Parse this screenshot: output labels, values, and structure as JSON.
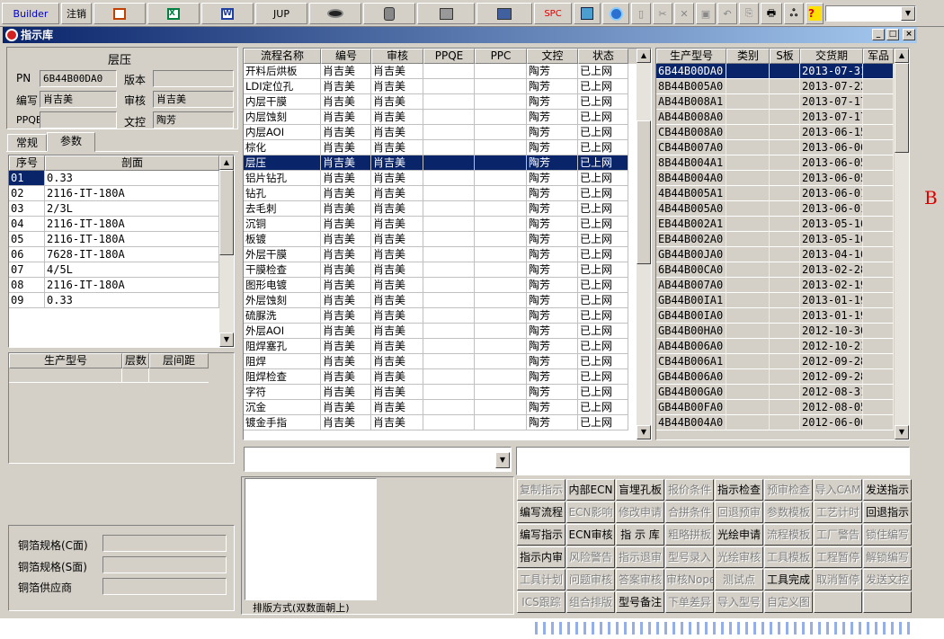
{
  "toolbar": {
    "builder": "Builder",
    "logout": "注销",
    "jup": "JUP",
    "spc": "SPC"
  },
  "window": {
    "title": "指示库"
  },
  "left": {
    "group_title": "层压",
    "pn_label": "PN",
    "pn_value": "6B44B00DA0",
    "version_label": "版本",
    "version_value": "",
    "writer_label": "编写",
    "writer_value": "肖吉美",
    "reviewer_label": "审核",
    "reviewer_value": "肖吉美",
    "ppqe_label": "PPQE",
    "ppqe_value": "",
    "doc_label": "文控",
    "doc_value": "陶芳",
    "tabs": [
      "常规",
      "参数"
    ],
    "param_headers": [
      "序号",
      "剖面"
    ],
    "params": [
      [
        "01",
        "0.33"
      ],
      [
        "02",
        "2116-IT-180A"
      ],
      [
        "03",
        "2/3L"
      ],
      [
        "04",
        "2116-IT-180A"
      ],
      [
        "05",
        "2116-IT-180A"
      ],
      [
        "06",
        "7628-IT-180A"
      ],
      [
        "07",
        "4/5L"
      ],
      [
        "08",
        "2116-IT-180A"
      ],
      [
        "09",
        "0.33"
      ]
    ],
    "model_headers": [
      "生产型号",
      "层数",
      "层间距"
    ],
    "copper_c_label": "铜箔规格(C面)",
    "copper_s_label": "铜箔规格(S面)",
    "copper_supplier_label": "铜箔供应商"
  },
  "process": {
    "headers": [
      "流程名称",
      "编号",
      "审核",
      "PPQE",
      "PPC",
      "文控",
      "状态"
    ],
    "rows": [
      [
        "开料后烘板",
        "肖吉美",
        "肖吉美",
        "",
        "",
        "陶芳",
        "已上网"
      ],
      [
        "LDI定位孔",
        "肖吉美",
        "肖吉美",
        "",
        "",
        "陶芳",
        "已上网"
      ],
      [
        "内层干膜",
        "肖吉美",
        "肖吉美",
        "",
        "",
        "陶芳",
        "已上网"
      ],
      [
        "内层蚀刻",
        "肖吉美",
        "肖吉美",
        "",
        "",
        "陶芳",
        "已上网"
      ],
      [
        "内层AOI",
        "肖吉美",
        "肖吉美",
        "",
        "",
        "陶芳",
        "已上网"
      ],
      [
        "棕化",
        "肖吉美",
        "肖吉美",
        "",
        "",
        "陶芳",
        "已上网"
      ],
      [
        "层压",
        "肖吉美",
        "肖吉美",
        "",
        "",
        "陶芳",
        "已上网"
      ],
      [
        "铝片钻孔",
        "肖吉美",
        "肖吉美",
        "",
        "",
        "陶芳",
        "已上网"
      ],
      [
        "钻孔",
        "肖吉美",
        "肖吉美",
        "",
        "",
        "陶芳",
        "已上网"
      ],
      [
        "去毛刺",
        "肖吉美",
        "肖吉美",
        "",
        "",
        "陶芳",
        "已上网"
      ],
      [
        "沉铜",
        "肖吉美",
        "肖吉美",
        "",
        "",
        "陶芳",
        "已上网"
      ],
      [
        "板镀",
        "肖吉美",
        "肖吉美",
        "",
        "",
        "陶芳",
        "已上网"
      ],
      [
        "外层干膜",
        "肖吉美",
        "肖吉美",
        "",
        "",
        "陶芳",
        "已上网"
      ],
      [
        "干膜检查",
        "肖吉美",
        "肖吉美",
        "",
        "",
        "陶芳",
        "已上网"
      ],
      [
        "图形电镀",
        "肖吉美",
        "肖吉美",
        "",
        "",
        "陶芳",
        "已上网"
      ],
      [
        "外层蚀刻",
        "肖吉美",
        "肖吉美",
        "",
        "",
        "陶芳",
        "已上网"
      ],
      [
        "硫脲洗",
        "肖吉美",
        "肖吉美",
        "",
        "",
        "陶芳",
        "已上网"
      ],
      [
        "外层AOI",
        "肖吉美",
        "肖吉美",
        "",
        "",
        "陶芳",
        "已上网"
      ],
      [
        "阻焊塞孔",
        "肖吉美",
        "肖吉美",
        "",
        "",
        "陶芳",
        "已上网"
      ],
      [
        "阻焊",
        "肖吉美",
        "肖吉美",
        "",
        "",
        "陶芳",
        "已上网"
      ],
      [
        "阻焊检查",
        "肖吉美",
        "肖吉美",
        "",
        "",
        "陶芳",
        "已上网"
      ],
      [
        "字符",
        "肖吉美",
        "肖吉美",
        "",
        "",
        "陶芳",
        "已上网"
      ],
      [
        "沉金",
        "肖吉美",
        "肖吉美",
        "",
        "",
        "陶芳",
        "已上网"
      ],
      [
        "镀金手指",
        "肖吉美",
        "肖吉美",
        "",
        "",
        "陶芳",
        "已上网"
      ]
    ]
  },
  "models": {
    "headers": [
      "生产型号",
      "类别",
      "S板",
      "交货期",
      "军品"
    ],
    "rows": [
      [
        "6B44B00DA0",
        "2013-07-31"
      ],
      [
        "8B44B005A0",
        "2013-07-22"
      ],
      [
        "AB44B008A1",
        "2013-07-17"
      ],
      [
        "AB44B008A0",
        "2013-07-17"
      ],
      [
        "CB44B008A0",
        "2013-06-15"
      ],
      [
        "CB44B007A0",
        "2013-06-06"
      ],
      [
        "8B44B004A1",
        "2013-06-05"
      ],
      [
        "8B44B004A0",
        "2013-06-05"
      ],
      [
        "4B44B005A1",
        "2013-06-01"
      ],
      [
        "4B44B005A0",
        "2013-06-01"
      ],
      [
        "EB44B002A1",
        "2013-05-16"
      ],
      [
        "EB44B002A0",
        "2013-05-16"
      ],
      [
        "GB44B00JA0",
        "2013-04-16"
      ],
      [
        "6B44B00CA0",
        "2013-02-28"
      ],
      [
        "AB44B007A0",
        "2013-02-19"
      ],
      [
        "GB44B00IA1",
        "2013-01-19"
      ],
      [
        "GB44B00IA0",
        "2013-01-19"
      ],
      [
        "GB44B00HA0",
        "2012-10-30"
      ],
      [
        "AB44B006A0",
        "2012-10-21"
      ],
      [
        "CB44B006A1",
        "2012-09-28"
      ],
      [
        "GB44B006A0",
        "2012-09-28"
      ],
      [
        "GB44B00GA0",
        "2012-08-31"
      ],
      [
        "GB44B00FA0",
        "2012-08-05"
      ],
      [
        "4B44B004A0",
        "2012-06-06"
      ]
    ]
  },
  "layout_mode": "排版方式(双数面朝上)",
  "buttons": [
    [
      [
        "复制指示",
        0
      ],
      [
        "内部ECN",
        1
      ],
      [
        "盲埋孔板",
        1
      ],
      [
        "报价条件",
        0
      ],
      [
        "指示检查",
        1
      ],
      [
        "预审检查",
        0
      ],
      [
        "导入CAM",
        0
      ],
      [
        "发送指示",
        1
      ]
    ],
    [
      [
        "编写流程",
        1
      ],
      [
        "ECN影响",
        0
      ],
      [
        "修改申请",
        0
      ],
      [
        "合拼条件",
        0
      ],
      [
        "回退预审",
        0
      ],
      [
        "参数模板",
        0
      ],
      [
        "工艺计时",
        0
      ],
      [
        "回退指示",
        1
      ]
    ],
    [
      [
        "编写指示",
        1
      ],
      [
        "ECN审核",
        1
      ],
      [
        "指 示 库",
        1
      ],
      [
        "粗略拼板",
        0
      ],
      [
        "光绘申请",
        1
      ],
      [
        "流程模板",
        0
      ],
      [
        "工厂警告",
        0
      ],
      [
        "锁住编写",
        0
      ]
    ],
    [
      [
        "指示内审",
        1
      ],
      [
        "风险警告",
        0
      ],
      [
        "指示退审",
        0
      ],
      [
        "型号录入",
        0
      ],
      [
        "光绘审核",
        0
      ],
      [
        "工具模板",
        0
      ],
      [
        "工程暂停",
        0
      ],
      [
        "解锁编写",
        0
      ]
    ],
    [
      [
        "工具计划",
        0
      ],
      [
        "问题审核",
        0
      ],
      [
        "答案审核",
        0
      ],
      [
        "审核Nope",
        0
      ],
      [
        "测试点",
        0
      ],
      [
        "工具完成",
        1
      ],
      [
        "取消暂停",
        0
      ],
      [
        "发送文控",
        0
      ]
    ],
    [
      [
        "ICS跟踪",
        0
      ],
      [
        "组合排版",
        0
      ],
      [
        "型号备注",
        1
      ],
      [
        "下单差异",
        0
      ],
      [
        "导入型号",
        0
      ],
      [
        "自定义图",
        0
      ],
      [
        "",
        0
      ],
      [
        "",
        0
      ]
    ]
  ],
  "bg_text": "B"
}
